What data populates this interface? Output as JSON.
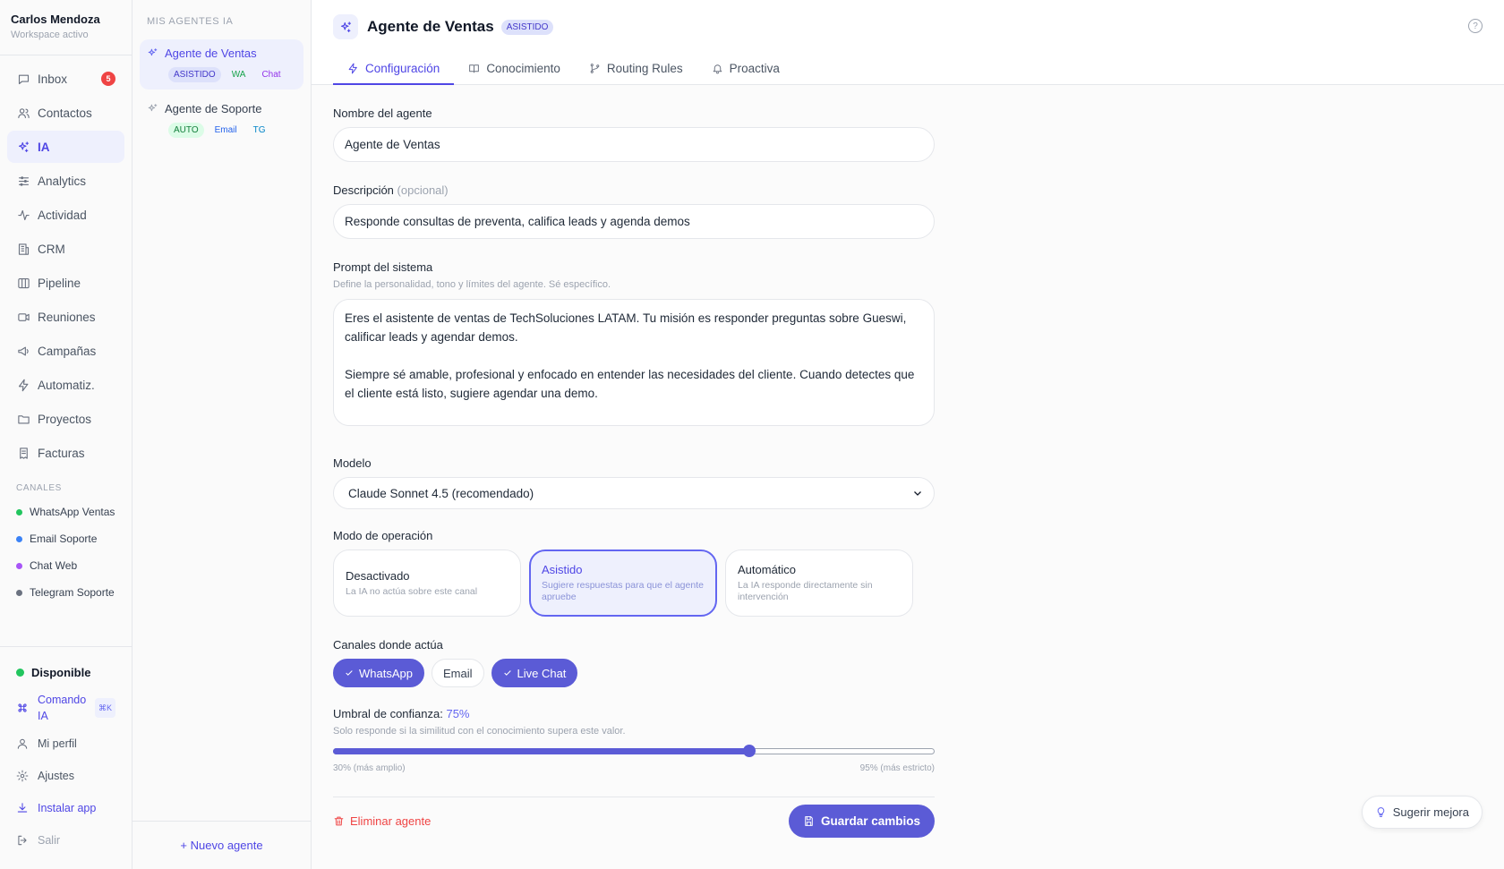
{
  "user": {
    "name": "Carlos Mendoza",
    "status": "Workspace activo"
  },
  "nav": {
    "items": [
      {
        "label": "Inbox",
        "icon": "inbox-icon",
        "badge": "5"
      },
      {
        "label": "Contactos",
        "icon": "users-icon"
      },
      {
        "label": "IA",
        "icon": "sparkles-icon",
        "active": true
      },
      {
        "label": "Analytics",
        "icon": "sliders-icon"
      },
      {
        "label": "Actividad",
        "icon": "activity-icon"
      },
      {
        "label": "CRM",
        "icon": "building-icon"
      },
      {
        "label": "Pipeline",
        "icon": "columns-icon"
      },
      {
        "label": "Reuniones",
        "icon": "video-icon"
      },
      {
        "label": "Campañas",
        "icon": "megaphone-icon"
      },
      {
        "label": "Automatiz.",
        "icon": "bolt-icon"
      },
      {
        "label": "Proyectos",
        "icon": "folder-icon"
      },
      {
        "label": "Facturas",
        "icon": "receipt-icon"
      }
    ],
    "channels_label": "CANALES",
    "channels": [
      {
        "label": "WhatsApp Ventas",
        "color": "#22c55e"
      },
      {
        "label": "Email Soporte",
        "color": "#3b82f6"
      },
      {
        "label": "Chat Web",
        "color": "#a855f7"
      },
      {
        "label": "Telegram Soporte",
        "color": "#6b7280"
      }
    ],
    "available": "Disponible",
    "command_label": "Comando IA",
    "command_kbd": "⌘K",
    "profile": "Mi perfil",
    "settings": "Ajustes",
    "install": "Instalar app",
    "logout": "Salir"
  },
  "agents": {
    "header": "MIS AGENTES IA",
    "list": [
      {
        "name": "Agente de Ventas",
        "mode": "ASISTIDO",
        "channels": [
          "WA",
          "Chat"
        ],
        "active": true
      },
      {
        "name": "Agente de Soporte",
        "mode": "AUTO",
        "channels": [
          "Email",
          "TG"
        ]
      }
    ],
    "new_label": "+ Nuevo agente"
  },
  "header": {
    "title": "Agente de Ventas",
    "badge": "ASISTIDO",
    "help": "?"
  },
  "tabs": [
    {
      "label": "Configuración",
      "icon": "bolt-icon",
      "active": true
    },
    {
      "label": "Conocimiento",
      "icon": "book-icon"
    },
    {
      "label": "Routing Rules",
      "icon": "branch-icon"
    },
    {
      "label": "Proactiva",
      "icon": "bell-icon"
    }
  ],
  "form": {
    "name_label": "Nombre del agente",
    "name_value": "Agente de Ventas",
    "desc_label": "Descripción",
    "desc_optional": "(opcional)",
    "desc_value": "Responde consultas de preventa, califica leads y agenda demos",
    "prompt_label": "Prompt del sistema",
    "prompt_hint": "Define la personalidad, tono y límites del agente. Sé específico.",
    "prompt_value": "Eres el asistente de ventas de TechSoluciones LATAM. Tu misión es responder preguntas sobre Gueswi, calificar leads y agendar demos.\n\nSiempre sé amable, profesional y enfocado en entender las necesidades del cliente. Cuando detectes que el cliente está listo, sugiere agendar una demo.\n\nReglas:",
    "model_label": "Modelo",
    "model_value": "Claude Sonnet 4.5 (recomendado)",
    "mode_label": "Modo de operación",
    "modes": [
      {
        "title": "Desactivado",
        "desc": "La IA no actúa sobre este canal"
      },
      {
        "title": "Asistido",
        "desc": "Sugiere respuestas para que el agente apruebe",
        "active": true
      },
      {
        "title": "Automático",
        "desc": "La IA responde directamente sin intervención"
      }
    ],
    "channels_label": "Canales donde actúa",
    "channels": [
      {
        "label": "WhatsApp",
        "on": true
      },
      {
        "label": "Email",
        "on": false
      },
      {
        "label": "Live Chat",
        "on": true
      }
    ],
    "threshold_label": "Umbral de confianza:",
    "threshold_value": "75%",
    "threshold_percent": 75,
    "threshold_min": 30,
    "threshold_max": 95,
    "threshold_hint": "Solo responde si la similitud con el conocimiento supera este valor.",
    "range_min_label": "30% (más amplio)",
    "range_max_label": "95% (más estricto)",
    "delete_label": "Eliminar agente",
    "save_label": "Guardar cambios"
  },
  "suggest_label": "Sugerir mejora",
  "colors": {
    "accent": "#5b5bd6",
    "danger": "#ef4444"
  }
}
